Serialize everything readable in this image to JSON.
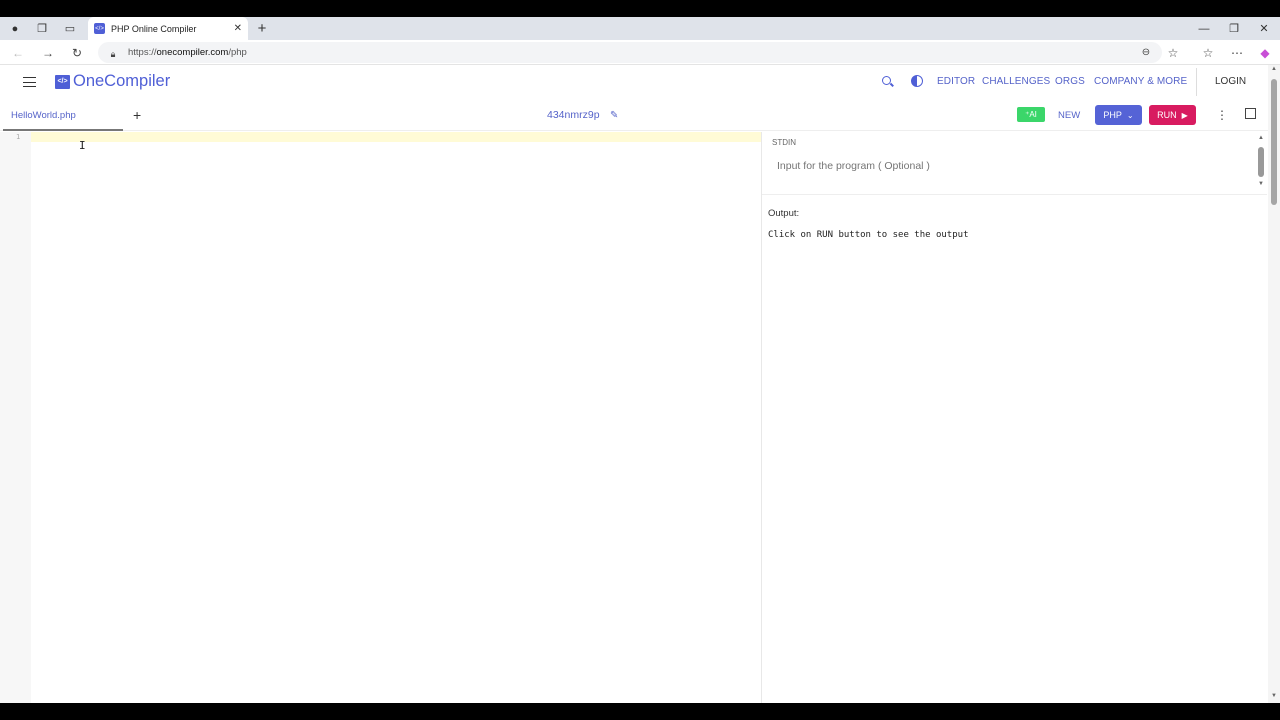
{
  "browser": {
    "tab_title": "PHP Online Compiler",
    "url_protocol": "https://",
    "url_host": "onecompiler.com",
    "url_path": "/php"
  },
  "header": {
    "logo_text": "OneCompiler",
    "logo_mark": "</>",
    "nav_items": [
      "EDITOR",
      "CHALLENGES",
      "ORGS",
      "COMPANY & MORE"
    ],
    "login_label": "LOGIN"
  },
  "editor_bar": {
    "file_name": "HelloWorld.php",
    "code_id": "434nmrz9p",
    "ai_label": "AI",
    "new_label": "NEW",
    "language_label": "PHP",
    "run_label": "RUN"
  },
  "editor": {
    "line_number": "1"
  },
  "stdin": {
    "label": "STDIN",
    "placeholder": "Input for the program ( Optional )"
  },
  "output": {
    "label": "Output:",
    "text": "Click on RUN button to see the output"
  },
  "colors": {
    "brand": "#4f5fd6",
    "run": "#d81b60",
    "ai": "#3bd66a"
  }
}
